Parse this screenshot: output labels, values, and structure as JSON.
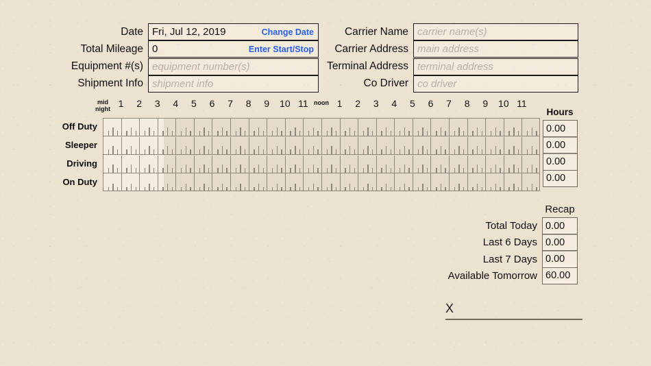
{
  "form": {
    "left_fields": [
      {
        "label": "Date",
        "value": "Fri, Jul 12, 2019",
        "placeholder": "",
        "action": "Change Date"
      },
      {
        "label": "Total Mileage",
        "value": "0",
        "placeholder": "",
        "action": "Enter Start/Stop"
      },
      {
        "label": "Equipment #(s)",
        "value": "",
        "placeholder": "equipment number(s)",
        "action": ""
      },
      {
        "label": "Shipment Info",
        "value": "",
        "placeholder": "shipment info",
        "action": ""
      }
    ],
    "right_fields": [
      {
        "label": "Carrier Name",
        "value": "",
        "placeholder": "carrier name(s)",
        "action": ""
      },
      {
        "label": "Carrier Address",
        "value": "",
        "placeholder": "main address",
        "action": ""
      },
      {
        "label": "Terminal Address",
        "value": "",
        "placeholder": "terminal address",
        "action": ""
      },
      {
        "label": "Co Driver",
        "value": "",
        "placeholder": "co driver",
        "action": ""
      }
    ]
  },
  "grid": {
    "hour_labels": [
      "mid\nnight",
      "1",
      "2",
      "3",
      "4",
      "5",
      "6",
      "7",
      "8",
      "9",
      "10",
      "11",
      "noon",
      "1",
      "2",
      "3",
      "4",
      "5",
      "6",
      "7",
      "8",
      "9",
      "10",
      "11"
    ],
    "midnight_line1": "mid",
    "midnight_line2": "night",
    "noon_label": "noon",
    "rows": [
      {
        "label": "Off Duty",
        "hours": "0.00"
      },
      {
        "label": "Sleeper",
        "hours": "0.00"
      },
      {
        "label": "Driving",
        "hours": "0.00"
      },
      {
        "label": "On Duty",
        "hours": "0.00"
      }
    ],
    "hours_header": "Hours"
  },
  "recap": {
    "title": "Recap",
    "rows": [
      {
        "label": "Total Today",
        "value": "0.00"
      },
      {
        "label": "Last 6 Days",
        "value": "0.00"
      },
      {
        "label": "Last 7 Days",
        "value": "0.00"
      },
      {
        "label": "Available Tomorrow",
        "value": "60.00"
      }
    ]
  },
  "signature": {
    "mark": "X"
  },
  "colors": {
    "paper": "#ece2d0",
    "accent_link": "#2b5fe3",
    "grid_line": "#8d887c",
    "field_border": "#1a1a1a",
    "placeholder": "#b7b0a4"
  }
}
